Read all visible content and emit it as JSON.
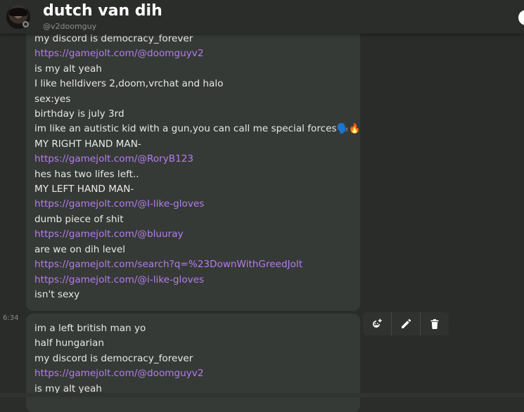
{
  "header": {
    "display_name": "dutch van dih",
    "username": "@v2doomguy"
  },
  "messages": [
    {
      "lines": [
        {
          "text": "my discord is democracy_forever",
          "link": false
        },
        {
          "text": "https://gamejolt.com/@doomguyv2",
          "link": true
        },
        {
          "text": "is my alt yeah",
          "link": false
        },
        {
          "text": "I like helldivers 2,doom,vrchat and halo",
          "link": false
        },
        {
          "text": "sex:yes",
          "link": false
        },
        {
          "text": "birthday is july 3rd",
          "link": false
        },
        {
          "text": "im like an autistic kid with a gun,you can call me special forces🗣️🔥",
          "link": false
        },
        {
          "text": "MY RIGHT HAND MAN-",
          "link": false
        },
        {
          "text": "https://gamejolt.com/@RoryB123",
          "link": true
        },
        {
          "text": "hes has two lifes left..",
          "link": false
        },
        {
          "text": "MY LEFT HAND MAN-",
          "link": false
        },
        {
          "text": "https://gamejolt.com/@I-like-gloves",
          "link": true
        },
        {
          "text": "dumb piece of shit",
          "link": false
        },
        {
          "text": "https://gamejolt.com/@bluuray",
          "link": true
        },
        {
          "text": "are we on dih level",
          "link": false
        },
        {
          "text": "https://gamejolt.com/search?q=%23DownWithGreedJolt",
          "link": true
        },
        {
          "text": "https://gamejolt.com/@i-like-gloves",
          "link": true
        },
        {
          "text": "isn't sexy",
          "link": false
        }
      ]
    },
    {
      "timestamp": "6:34",
      "lines": [
        {
          "text": "im a left british man yo",
          "link": false
        },
        {
          "text": "half hungarian",
          "link": false
        },
        {
          "text": "my discord is democracy_forever",
          "link": false
        },
        {
          "text": "https://gamejolt.com/@doomguyv2",
          "link": true
        },
        {
          "text": "is my alt yeah",
          "link": false
        }
      ]
    }
  ],
  "toolbar": {
    "icons": [
      "add-reaction-icon",
      "edit-icon",
      "delete-icon"
    ]
  },
  "colors": {
    "background": "#2a2c2a",
    "bubble": "#363a36",
    "link": "#b57cf0",
    "text": "#e8e8e8"
  }
}
